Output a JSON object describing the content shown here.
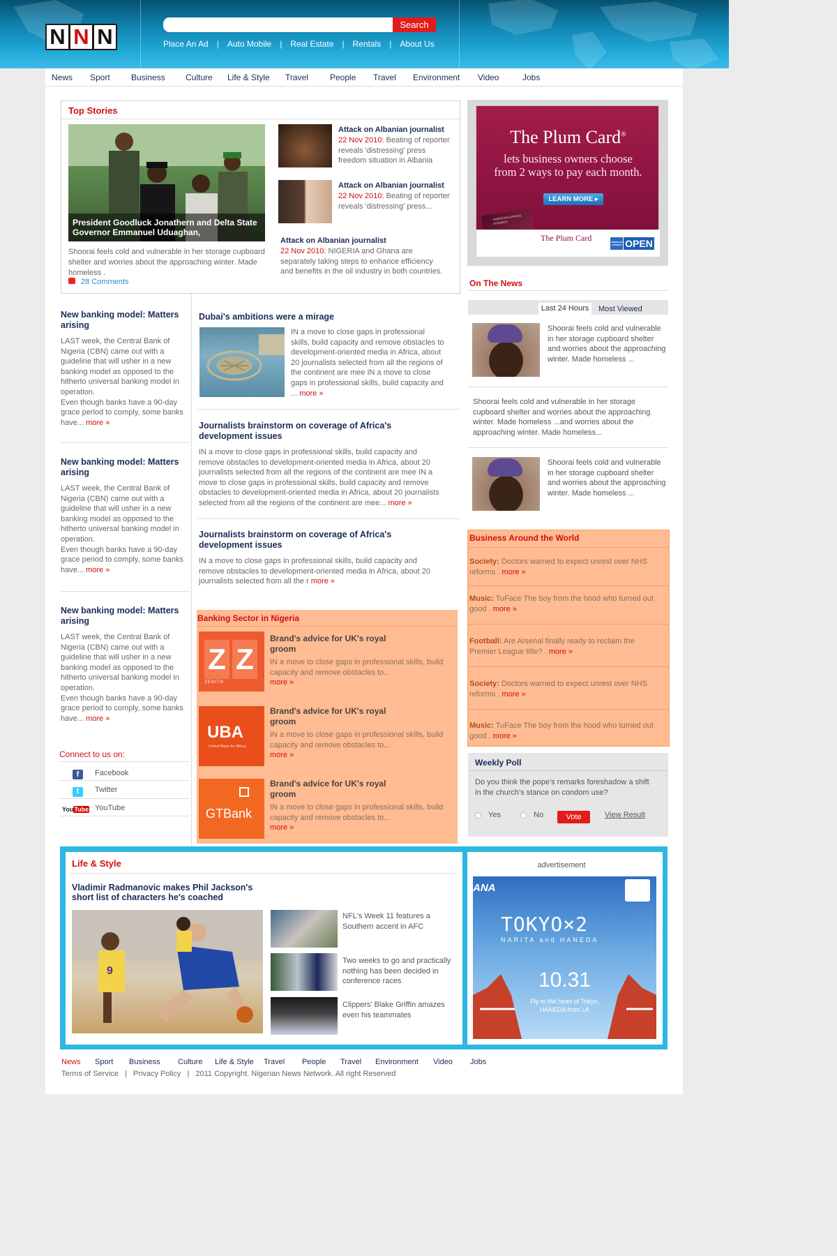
{
  "brand": {
    "logo_letters": [
      "N",
      "N",
      "N"
    ]
  },
  "search": {
    "placeholder": "",
    "button": "Search"
  },
  "top_links": [
    "Place An Ad",
    "Auto Mobile",
    "Real Estate",
    "Rentals",
    "About Us"
  ],
  "top_link_separator": "|",
  "main_nav": [
    "News",
    "Sport",
    "Business",
    "Culture",
    "Life & Style",
    "Travel",
    "People",
    "Travel",
    "Environment",
    "Video",
    "Jobs"
  ],
  "top_stories": {
    "title": "Top Stories",
    "main_caption": "President Goodluck Jonathern and Delta State Governor Emmanuel Uduaghan,",
    "main_text": "Shoorai feels cold and vulnerable in her storage cupboard shelter and worries about the approaching winter. Made homeless .",
    "comments": "28 Comments",
    "side": [
      {
        "title": "Attack on Albanian journalist",
        "date": "22 Nov 2010:",
        "text": "Beating of reporter reveals 'distressing' press freedom situation in Albania"
      },
      {
        "title": "Attack on Albanian journalist",
        "date": "22 Nov 2010:",
        "text": "Beating of reporter reveals 'distressing' press..."
      },
      {
        "title": "Attack on Albanian journalist",
        "date": "22 Nov 2010:",
        "text": "NIGERIA and Ghana are separately taking steps to enhance efficiency and benefits in the oil industry in both countries."
      }
    ]
  },
  "ad_plum": {
    "headline": "The Plum Card",
    "reg": "®",
    "sub1": "lets business owners choose",
    "sub2": "from 2 ways to pay each month.",
    "cta": "LEARN MORE",
    "card_brand": "The Plum Card",
    "card_top": "AMERICAN EXPRESS",
    "card_sub": "BUSINESS",
    "amex": "AMERICAN EXPRESS",
    "open": "OPEN"
  },
  "left_column": [
    {
      "title": "New banking model: Matters arising",
      "text": "LAST week, the Central Bank of Nigeria (CBN) came out with a guideline that will usher in a new banking model as opposed to the hitherto universal banking model in operation.",
      "text2": "Even though banks have a 90-day grace period to comply, some banks have...",
      "more": "more"
    },
    {
      "title": "New banking model: Matters arising",
      "text": "LAST week, the Central Bank of Nigeria (CBN) came out with a guideline that will usher in a new banking model as opposed to the hitherto universal banking model in operation.",
      "text2": "Even though banks have a 90-day grace period to comply, some banks have...",
      "more": "more"
    },
    {
      "title": "New banking model: Matters arising",
      "text": "LAST week, the Central Bank of Nigeria (CBN) came out with a guideline that will usher in a new banking model as opposed to the hitherto universal banking model in operation.",
      "text2": "Even though banks have a 90-day grace period to comply, some banks have...",
      "more": "more"
    }
  ],
  "connect": {
    "title": "Connect to us on:",
    "items": [
      {
        "label": "Facebook",
        "icon": "facebook-icon",
        "glyph": "f"
      },
      {
        "label": "Twitter",
        "icon": "twitter-icon",
        "glyph": "t"
      },
      {
        "label": "YouTube",
        "icon": "youtube-icon",
        "glyph": "You",
        "glyph2": "Tube"
      }
    ]
  },
  "middle": {
    "dubai": {
      "title": "Dubai's ambitions were a mirage",
      "text": "IN a move to close gaps in professional skills, build capacity and remove obstacles to development-oriented media in Africa, about 20 journalists selected from all the regions of the continent are mee IN a move to close gaps in professional skills, build capacity and ...",
      "more": "more"
    },
    "brainstorm1": {
      "title": "Journalists brainstorm on coverage of Africa's development issues",
      "text": "IN a move to close gaps in professional skills, build capacity and remove obstacles to development-oriented media in Africa, about 20 journalists selected from all the regions of the continent are mee IN a move to close gaps in professional skills, build capacity and remove obstacles to development-oriented media in Africa, about 20 journalists selected from all the regions of the continent are mee...",
      "more": "more"
    },
    "brainstorm2": {
      "title": "Journalists brainstorm on coverage of Africa's development issues",
      "text": "IN a move to close gaps in professional skills, build capacity and remove obstacles to development-oriented media in Africa, about 20 journalists selected from all the r",
      "more": "more"
    }
  },
  "banking": {
    "title": "Banking Sector in Nigeria",
    "items": [
      {
        "title": "Brand's advice for UK's royal groom",
        "text": "IN a move to close gaps in professional skills, build capacity and remove obstacles to...",
        "more": "more",
        "logo": "zenith"
      },
      {
        "title": "Brand's advice for UK's royal groom",
        "text": "IN a move to close gaps in professional skills, build capacity and remove obstacles to...",
        "more": "more",
        "logo": "uba"
      },
      {
        "title": "Brand's advice for UK's royal groom",
        "text": "IN a move to close gaps in professional skills, build capacity and remove obstacles to...",
        "more": "more",
        "logo": "gtbank"
      }
    ],
    "logos": {
      "zenith_word": "ZENITH",
      "uba": "UBA",
      "uba_sub": "United Bank for Africa",
      "gtbank": "GTBank"
    }
  },
  "on_the_news": {
    "title": "On The News",
    "tabs": [
      "Last 24 Hours",
      "Most Viewed"
    ],
    "items": [
      {
        "text": "Shoorai feels cold and vulnerable in her storage cupboard shelter and worries about the approaching winter. Made homeless ..."
      },
      {
        "text": "Shoorai feels cold and vulnerable in her storage cupboard shelter and worries about the approaching winter. Made homeless ...and worries about the approaching winter. Made homeless..."
      },
      {
        "text": "Shoorai feels cold and vulnerable in her storage cupboard shelter and worries about the approaching winter. Made homeless ..."
      }
    ]
  },
  "business_world": {
    "title": "Business Around the World",
    "items": [
      {
        "label": "Society:",
        "text": "Doctors warned to expect unrest over NHS reforms .",
        "more": "more"
      },
      {
        "label": "Music:",
        "text": "TuFace The boy from the hood who turned out good .",
        "more": "more"
      },
      {
        "label": "Football:",
        "text": "Are Arsenal finally ready to reclaim the Premier League title? .",
        "more": "more"
      },
      {
        "label": "Society:",
        "text": "Doctors warned to expect unrest over NHS reforms .",
        "more": "more"
      },
      {
        "label": "Music:",
        "text": "TuFace The boy from the hood who turned out good .",
        "more": "more"
      }
    ]
  },
  "poll": {
    "title": "Weekly Poll",
    "question": "Do you think the pope's remarks foreshadow a shift in the church's stance on condom use?",
    "options": [
      "Yes",
      "No"
    ],
    "vote": "Vote",
    "view": "View Result"
  },
  "life_style": {
    "title": "Life & Style",
    "headline": "Vladimir Radmanovic makes Phil Jackson's short list of characters he's coached",
    "items": [
      {
        "text": "NFL's Week 11 features a Southern accent in AFC"
      },
      {
        "text": "Two weeks to go and practically nothing has been decided in conference races"
      },
      {
        "text": "Clippers' Blake Griffin amazes even his teammates"
      }
    ]
  },
  "ad_ana": {
    "label": "advertisement",
    "brand": "ANA",
    "title": "TOKYO×2",
    "sub": "NARITA and HANEDA",
    "date": "10.31",
    "line1": "Fly to the heart of Tokyo,",
    "line2": "HANEDA from LA"
  },
  "footer": {
    "nav": [
      "News",
      "Sport",
      "Business",
      "Culture",
      "Life & Style",
      "Travel",
      "People",
      "Travel",
      "Environment",
      "Video",
      "Jobs"
    ],
    "links": [
      "Terms of Service",
      "Privacy Policy",
      "2011 Copyright. Nigerian News Network. All right Reserved"
    ],
    "sep": "|"
  },
  "colors": {
    "accent_red": "#d10f0f",
    "navy": "#1b2c57",
    "header_blue": "#21a9d8",
    "orange_box": "#ffbb91",
    "frame_blue": "#2cb8e2"
  }
}
